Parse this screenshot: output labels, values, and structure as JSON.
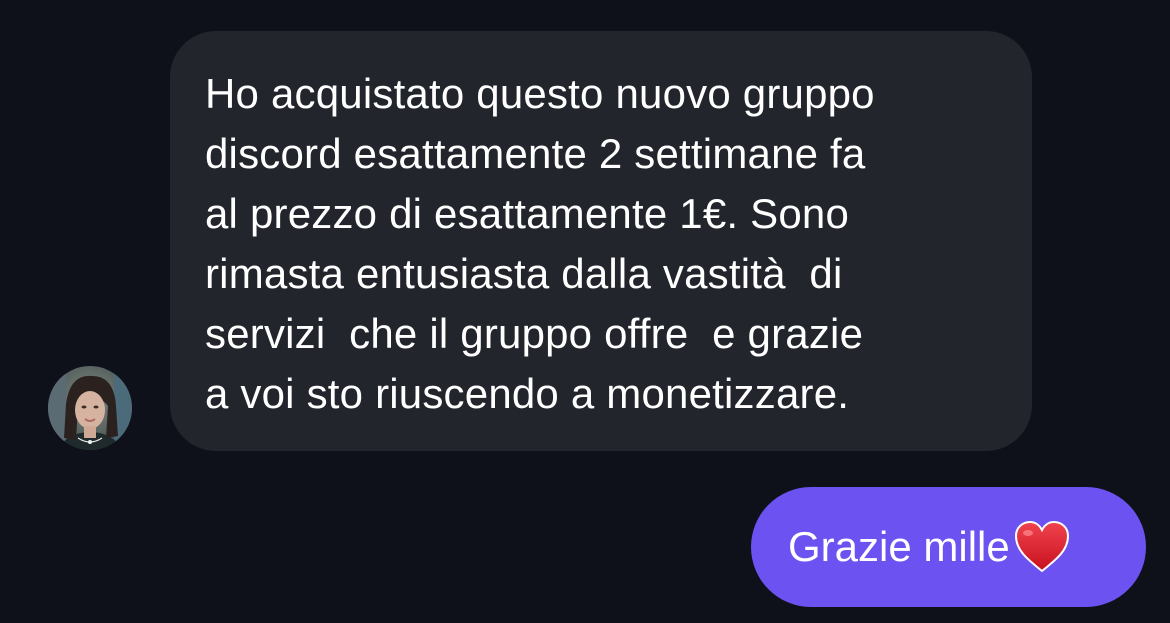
{
  "incoming_message": {
    "lines": [
      "Ho acquistato questo nuovo gruppo",
      "discord esattamente 2 settimane fa",
      "al prezzo di esattamente 1€. Sono",
      "rimasta entusiasta dalla vastità  di",
      "servizi  che il gruppo offre  e grazie",
      "a voi sto riuscendo a monetizzare."
    ]
  },
  "outgoing_message": {
    "text": "Grazie mille",
    "emoji_icon": "red-heart-icon"
  },
  "colors": {
    "background": "#0e111a",
    "incoming_bubble": "#22252c",
    "outgoing_bubble": "#6c52f0",
    "text": "#ffffff",
    "heart": "#e0202e"
  }
}
